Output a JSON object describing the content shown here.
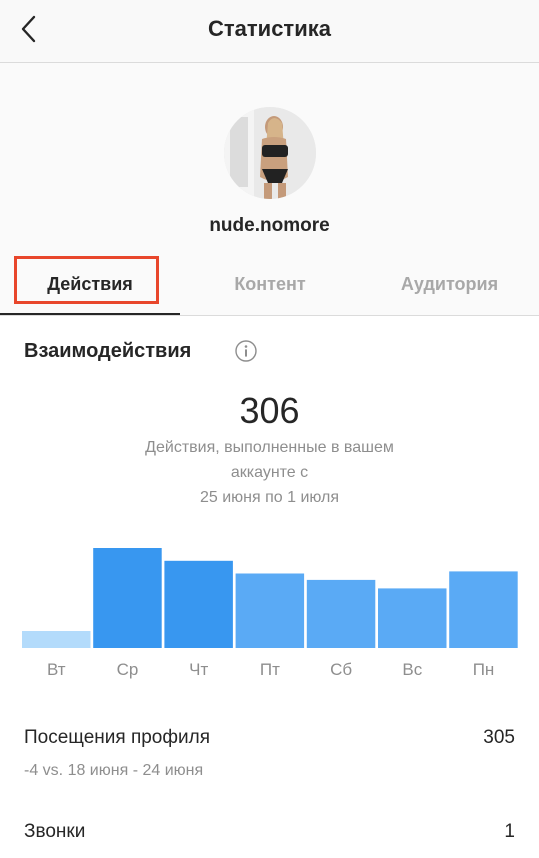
{
  "header": {
    "title": "Статистика",
    "back_icon": "chevron-left-icon"
  },
  "profile": {
    "username": "nude.nomore",
    "avatar": "avatar-photo"
  },
  "tabs": [
    {
      "label": "Действия",
      "active": true
    },
    {
      "label": "Контент",
      "active": false
    },
    {
      "label": "Аудитория",
      "active": false
    }
  ],
  "colors": {
    "highlight": "#e8462b",
    "bar_light": "#b3dbfb",
    "bar_dark": "#3897f0",
    "bar_mid": "#5aaaf5"
  },
  "interactions": {
    "title": "Взаимодействия",
    "info_icon": "info-icon",
    "total": "306",
    "description_line1": "Действия, выполненные в вашем",
    "description_line2": "аккаунте с",
    "description_line3": "25 июня по 1 июля"
  },
  "chart_data": {
    "type": "bar",
    "categories": [
      "Вт",
      "Ср",
      "Чт",
      "Пт",
      "Сб",
      "Вс",
      "Пн"
    ],
    "values": [
      8,
      47,
      41,
      35,
      32,
      28,
      36
    ],
    "bar_colors": [
      "#b3dbfb",
      "#3897f0",
      "#3897f0",
      "#5aaaf5",
      "#5aaaf5",
      "#5aaaf5",
      "#5aaaf5"
    ],
    "ylim": [
      0,
      47
    ],
    "grid": false,
    "title": "",
    "xlabel": "",
    "ylabel": ""
  },
  "stats": {
    "profile_visits_label": "Посещения профиля",
    "profile_visits_value": "305",
    "profile_visits_sub": "-4 vs. 18 июня - 24 июня",
    "calls_label": "Звонки",
    "calls_value": "1"
  }
}
